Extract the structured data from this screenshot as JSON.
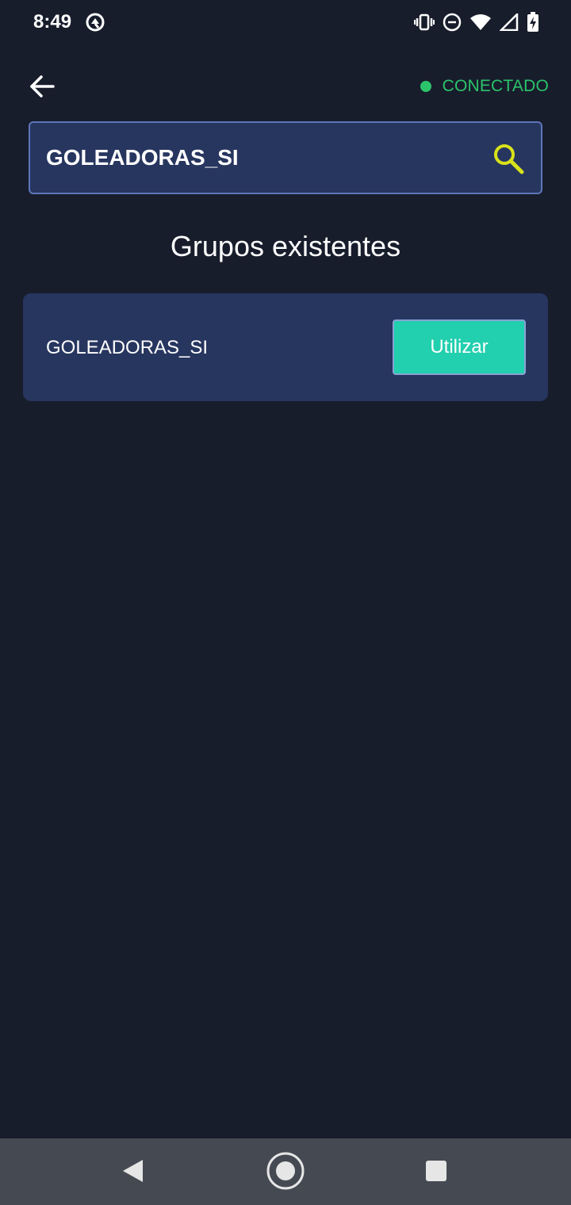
{
  "status_bar": {
    "time": "8:49",
    "icons": [
      "app-notification-icon",
      "vibrate-icon",
      "do-not-disturb-icon",
      "wifi-icon",
      "cell-signal-icon",
      "battery-charging-icon"
    ]
  },
  "header": {
    "back_icon": "arrow-left-icon",
    "connection_status": "CONECTADO",
    "connection_color": "#2bc46b"
  },
  "search": {
    "value": "GOLEADORAS_SI",
    "icon": "search-icon",
    "icon_color": "#d8e21a"
  },
  "section": {
    "title": "Grupos existentes"
  },
  "groups": [
    {
      "name": "GOLEADORAS_SI",
      "action_label": "Utilizar"
    }
  ],
  "nav_bar": {
    "icons": [
      "nav-back-icon",
      "nav-home-icon",
      "nav-recents-icon"
    ]
  },
  "colors": {
    "background": "#181d2c",
    "card": "#27365f",
    "accent_button": "#22cfae"
  }
}
